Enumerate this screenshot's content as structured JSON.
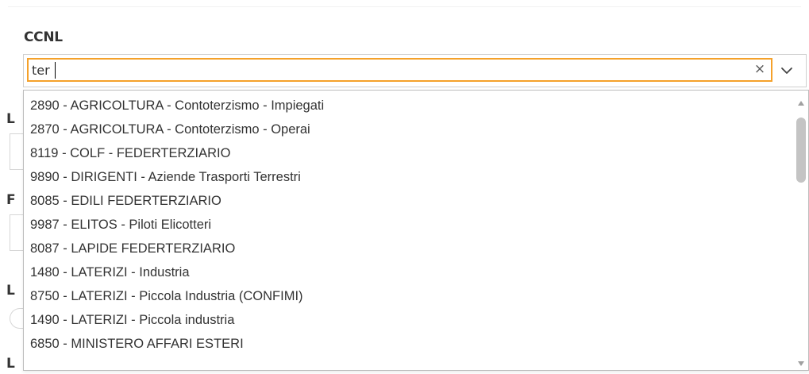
{
  "field": {
    "label": "CCNL",
    "search_value": "ter",
    "clear_symbol": "×"
  },
  "dropdown": {
    "options": [
      "2890 - AGRICOLTURA - Contoterzismo - Impiegati",
      "2870 - AGRICOLTURA - Contoterzismo - Operai",
      "8119 - COLF - FEDERTERZIARIO",
      "9890 - DIRIGENTI - Aziende Trasporti Terrestri",
      "8085 - EDILI FEDERTERZIARIO",
      "9987 - ELITOS - Piloti Elicotteri",
      "8087 - LAPIDE FEDERTERZIARIO",
      "1480 - LATERIZI - Industria",
      "8750 - LATERIZI - Piccola Industria (CONFIMI)",
      "1490 - LATERIZI - Piccola industria",
      "6850 - MINISTERO AFFARI ESTERI"
    ]
  },
  "background_fragments": {
    "label_1": "L",
    "label_2": "F",
    "label_3": "L",
    "label_4": "L"
  },
  "colors": {
    "focus_border": "#f5a12a",
    "scroll_thumb": "#c4c4c4",
    "text": "#333333"
  }
}
